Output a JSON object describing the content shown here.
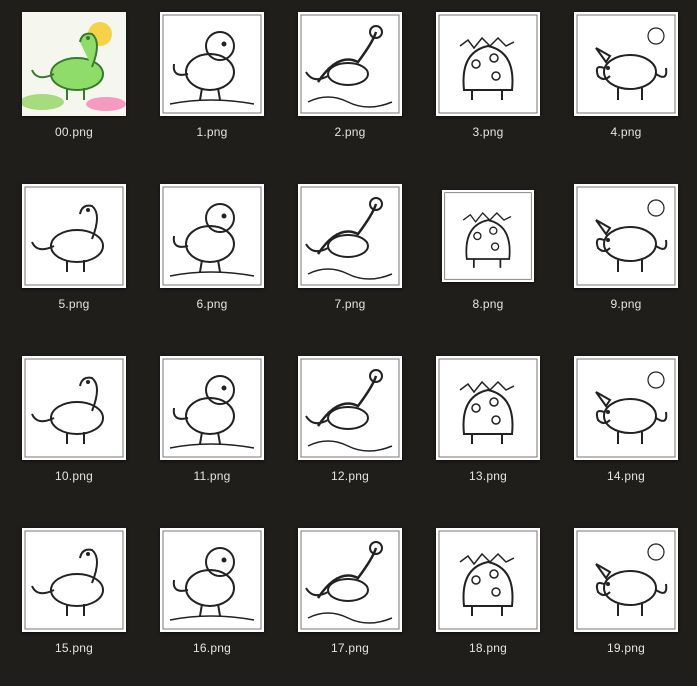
{
  "files": [
    {
      "name": "00.png",
      "icon": "dinosaur-color-icon",
      "color": "#7fd36b"
    },
    {
      "name": "1.png",
      "icon": "dinosaur-river-icon"
    },
    {
      "name": "2.png",
      "icon": "dinosaur-running-icon"
    },
    {
      "name": "3.png",
      "icon": "dinosaur-nest-icon"
    },
    {
      "name": "4.png",
      "icon": "dinosaur-nest-icon"
    },
    {
      "name": "5.png",
      "icon": "trex-jungle-icon"
    },
    {
      "name": "6.png",
      "icon": "dinosaur-snow-icon"
    },
    {
      "name": "7.png",
      "icon": "plesiosaur-icon"
    },
    {
      "name": "8.png",
      "icon": "stegosaurus-icon"
    },
    {
      "name": "9.png",
      "icon": "pterodactyl-jungle-icon"
    },
    {
      "name": "10.png",
      "icon": "stegosaurus-icon"
    },
    {
      "name": "11.png",
      "icon": "dinosaur-cute-icon"
    },
    {
      "name": "12.png",
      "icon": "brachiosaurus-icon"
    },
    {
      "name": "13.png",
      "icon": "triceratops-flowers-icon"
    },
    {
      "name": "14.png",
      "icon": "triceratops-icon"
    },
    {
      "name": "15.png",
      "icon": "brachiosaurus-icon"
    },
    {
      "name": "16.png",
      "icon": "dinosaur-cute-icon"
    },
    {
      "name": "17.png",
      "icon": "dinosaur-wings-icon"
    },
    {
      "name": "18.png",
      "icon": "playground-swing-icon"
    },
    {
      "name": "19.png",
      "icon": "playground-slide-icon"
    }
  ],
  "colors": {
    "background": "#1f1e1b",
    "label": "#e6e4df",
    "thumb_bg": "#ffffff"
  }
}
